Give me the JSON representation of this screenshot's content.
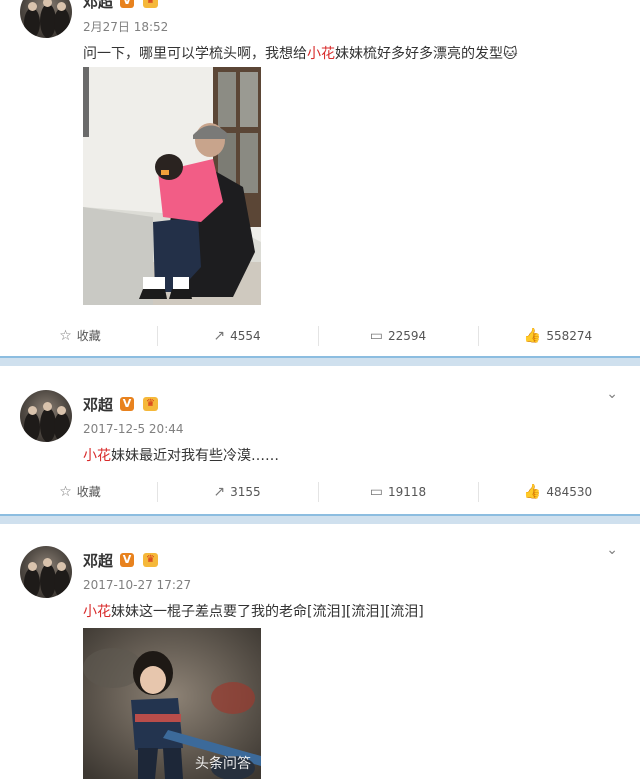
{
  "posts": [
    {
      "date": "2月27日 18:52",
      "text_pre": "问一下，哪里可以学梳头啊，我想给",
      "text_hl": "小花",
      "text_post": "妹妹梳好多好多漂亮的发型",
      "emoji": "🐱",
      "actions": {
        "fav": "收藏",
        "repost": "4554",
        "comment": "22594",
        "like": "558274"
      }
    },
    {
      "name": "邓超",
      "date": "2017-12-5 20:44",
      "text_hl": "小花",
      "text_post": "妹妹最近对我有些冷漠……",
      "actions": {
        "fav": "收藏",
        "repost": "3155",
        "comment": "19118",
        "like": "484530"
      }
    },
    {
      "name": "邓超",
      "date": "2017-10-27 17:27",
      "text_hl": "小花",
      "text_post": "妹妹这一棍子差点要了我的老命[流泪][流泪][流泪]"
    }
  ],
  "badges": {
    "v": "V",
    "crown": "♛"
  },
  "name_top": "邓超",
  "watermark": "头条问答",
  "colors": {
    "highlight": "#d82b2b",
    "divider": "#cfe0ee",
    "verified": "#e8821e"
  }
}
